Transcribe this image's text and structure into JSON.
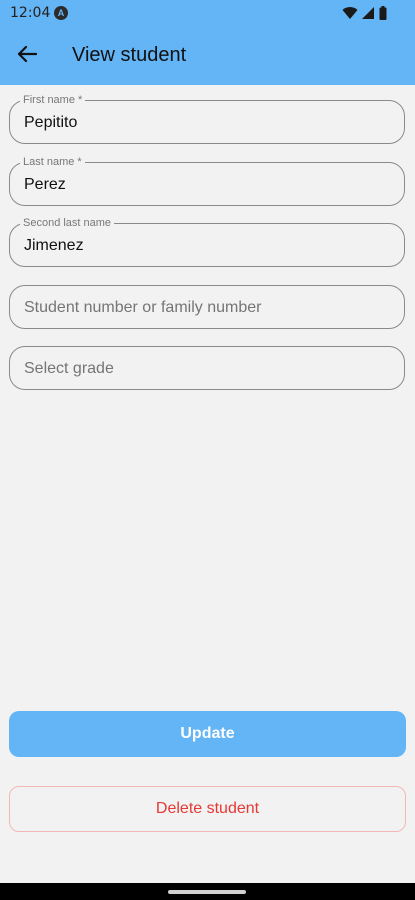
{
  "status_bar": {
    "time": "12:04",
    "badge": "A"
  },
  "app_bar": {
    "title": "View student"
  },
  "form": {
    "first_name": {
      "label": "First name *",
      "value": "Pepitito"
    },
    "last_name": {
      "label": "Last name *",
      "value": "Perez"
    },
    "second_last_name": {
      "label": "Second last name",
      "value": "Jimenez"
    },
    "student_number": {
      "placeholder": "Student number or family number"
    },
    "grade": {
      "placeholder": "Select grade"
    }
  },
  "actions": {
    "update_label": "Update",
    "delete_label": "Delete student"
  },
  "colors": {
    "primary": "#64b5f6",
    "danger": "#e53935",
    "background": "#f2f2f2"
  }
}
